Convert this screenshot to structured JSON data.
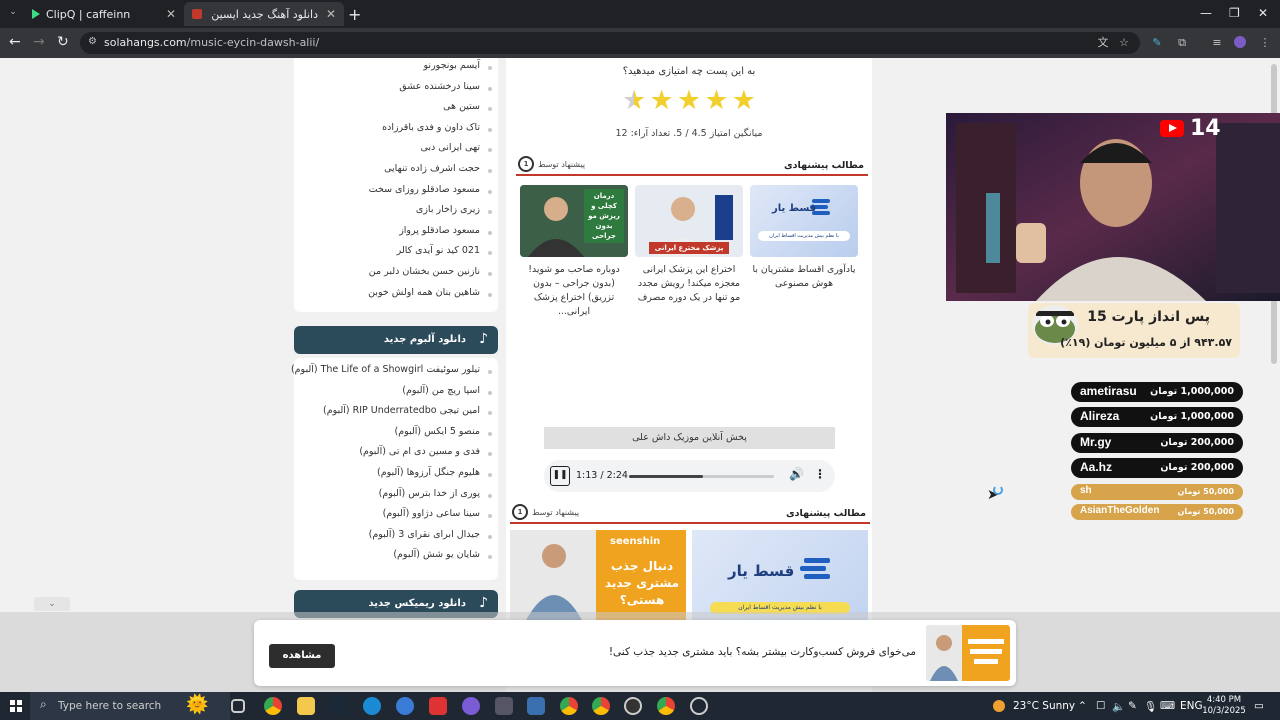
{
  "browser": {
    "tabs": [
      {
        "title": "ClipQ | caffeinn",
        "active": false
      },
      {
        "title": "دانلود آهنگ جدید ایسین داش",
        "active": true
      }
    ],
    "url_host": "solahangs.com",
    "url_path": "/music-eycin-dawsh-alii/"
  },
  "sidebar": {
    "singers": [
      "آیسم بونجورنو",
      "سینا درخشنده عشق",
      "ستین هی",
      "تاک داون و فدی باقرزاده",
      "تهی ایرانی دبی",
      "حجت اشرف زاده تنهایی",
      "مسعود صادقلو روزای سخت",
      "زیری زاخار بازی",
      "مسعود صادقلو پرواز",
      "021 کید نو آیدی کالر",
      "نازنین حسن بخشان دلبر من",
      "شاهین بنان همه اولش خوبن"
    ],
    "album_header": "دانلود آلبوم جدید",
    "albums": [
      "تیلور سوئیفت The Life of a Showgirl (آلبوم)",
      "اسپا ریچ من (آلبوم)",
      "امین تیجی RIP Underratedbo (آلبوم)",
      "منصو 5 ایکس (آلبوم)",
      "فدی و مسین دی ام تی (آلبوم)",
      "هلیوم جنگل آرزوها (آلبوم)",
      "پوری از خدا بترس (آلبوم)",
      "سینا ساعی دژاوو (آلبوم)",
      "جیدال ابرای نقرای 3 (آلبوم)",
      "شایان یو شش (آلبوم)"
    ],
    "remix_header": "دانلود ریمیکس جدید"
  },
  "main": {
    "rating_question": "به این پست چه امتیازی میدهید؟",
    "rating": 4.5,
    "rating_summary": "میانگین امتیاز 4.5 / 5. تعداد آراء: 12",
    "related_title": "مطالب پیشنهادی",
    "suggested_by": "پیشنهاد توسط",
    "related_posts": [
      {
        "caption": "یادآوری اقساط مشتریان با هوش مصنوعی",
        "thumb_text": "قسط یار",
        "thumb_sub": "با نظم بیش مدیریت اقساط ایران"
      },
      {
        "caption": "اختراع این پزشک ایرانی معجزه میکند! رویش مجدد مو تنها در یک دوره مصرف",
        "thumb_text": "پزشک مخترع ایرانی"
      },
      {
        "caption": "دوباره صاحب مو شوید! (بدون جراحی – بدون تزریق) اختراع پزشک ایرانی...",
        "thumb_text": "درمان کچلی و ریزش مو بدون جراحی"
      }
    ],
    "player_label": "پخش آنلاین موزیک داش علی",
    "player_time": "1:13 / 2:24",
    "player_progress": 0.507,
    "related_title_2": "مطالب پیشنهادی",
    "banner_right_text": "قسط یار",
    "banner_right_sub": "با نظم بیش مدیریت اقساط ایران",
    "banner_left_brand": "seenshin",
    "banner_left_text": "دنبال جذب مشتری جدید هستی؟"
  },
  "stream": {
    "youtube_count": "14",
    "goal_title": "پس انداز پارت 15",
    "goal_sub": "۹۴۳.۵۷ از ۵ میلیون تومان (۱۹٪)",
    "donations": [
      {
        "name": "ametirasu",
        "amount": "1,000,000 تومان"
      },
      {
        "name": "Alireza",
        "amount": "1,000,000 تومان"
      },
      {
        "name": "Mr.gy",
        "amount": "200,000 تومان"
      },
      {
        "name": "Aa.hz",
        "amount": "200,000 تومان"
      },
      {
        "name": "sh",
        "amount": "50,000 تومان"
      },
      {
        "name": "AsianTheGolden",
        "amount": "50,000 تومان"
      }
    ]
  },
  "popup": {
    "button": "مشاهده",
    "text": "می‌خوای فروش کسب‌وکارت بیشتر بشه؟ باید مشتری جدید جذب کنی!"
  },
  "taskbar": {
    "search_placeholder": "Type here to search",
    "weather": "23°C  Sunny",
    "time": "4:40 PM",
    "date": "10/3/2025"
  },
  "colors": {
    "sidebar_header": "#2b4a5a",
    "accent_red": "#c0392b",
    "star": "#f3cf2e",
    "donation_top": "#111111",
    "donation_small": "#d7a34b"
  }
}
